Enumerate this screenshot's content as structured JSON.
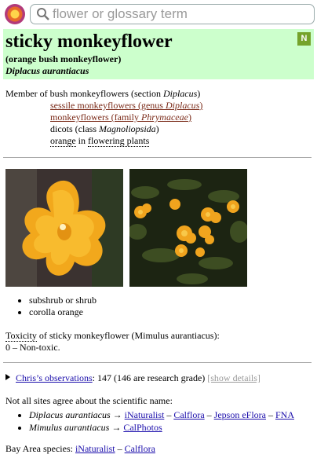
{
  "search": {
    "placeholder": "flower or glossary term"
  },
  "header": {
    "common_name": "sticky monkeyflower",
    "alt_name": "(orange bush monkeyflower)",
    "scientific_name": "Diplacus aurantiacus",
    "badge": "N",
    "badge_color": "#75a32b",
    "background_color": "#ccffcc"
  },
  "taxonomy": {
    "member_prefix": "Member of bush monkeyflowers (section ",
    "member_section": "Diplacus",
    "member_suffix": ")",
    "genus_prefix": "sessile monkeyflowers (genus ",
    "genus_name": "Diplacus",
    "genus_suffix": ")",
    "family_prefix": "monkeyflowers (family ",
    "family_name": "Phrymaceae",
    "family_suffix": ")",
    "class_prefix": "dicots (class ",
    "class_name": "Magnoliopsida",
    "class_suffix": ")",
    "color_word": "orange",
    "in_word": " in ",
    "flowering_plants": "flowering plants"
  },
  "traits": [
    "subshrub or shrub",
    "corolla orange"
  ],
  "toxicity": {
    "label": "Toxicity",
    "text": " of sticky monkeyflower (Mimulus aurantiacus):",
    "value": "0 – Non-toxic."
  },
  "observations": {
    "link": "Chris’s observations",
    "text": ": 147 (146 are research grade) ",
    "show_details": "[show details]"
  },
  "scientific_names": {
    "intro": "Not all sites agree about the scientific name:",
    "items": [
      {
        "name": "Diplacus aurantiacus",
        "arrow": " → ",
        "links": [
          "iNaturalist",
          "Calflora",
          "Jepson eFlora",
          "FNA"
        ],
        "sep": " – "
      },
      {
        "name": "Mimulus aurantiacus",
        "arrow": " → ",
        "links": [
          "CalPhotos"
        ]
      }
    ]
  },
  "bay_area": {
    "label": "Bay Area species: ",
    "links": [
      "iNaturalist",
      "Calflora"
    ],
    "sep": " – "
  }
}
